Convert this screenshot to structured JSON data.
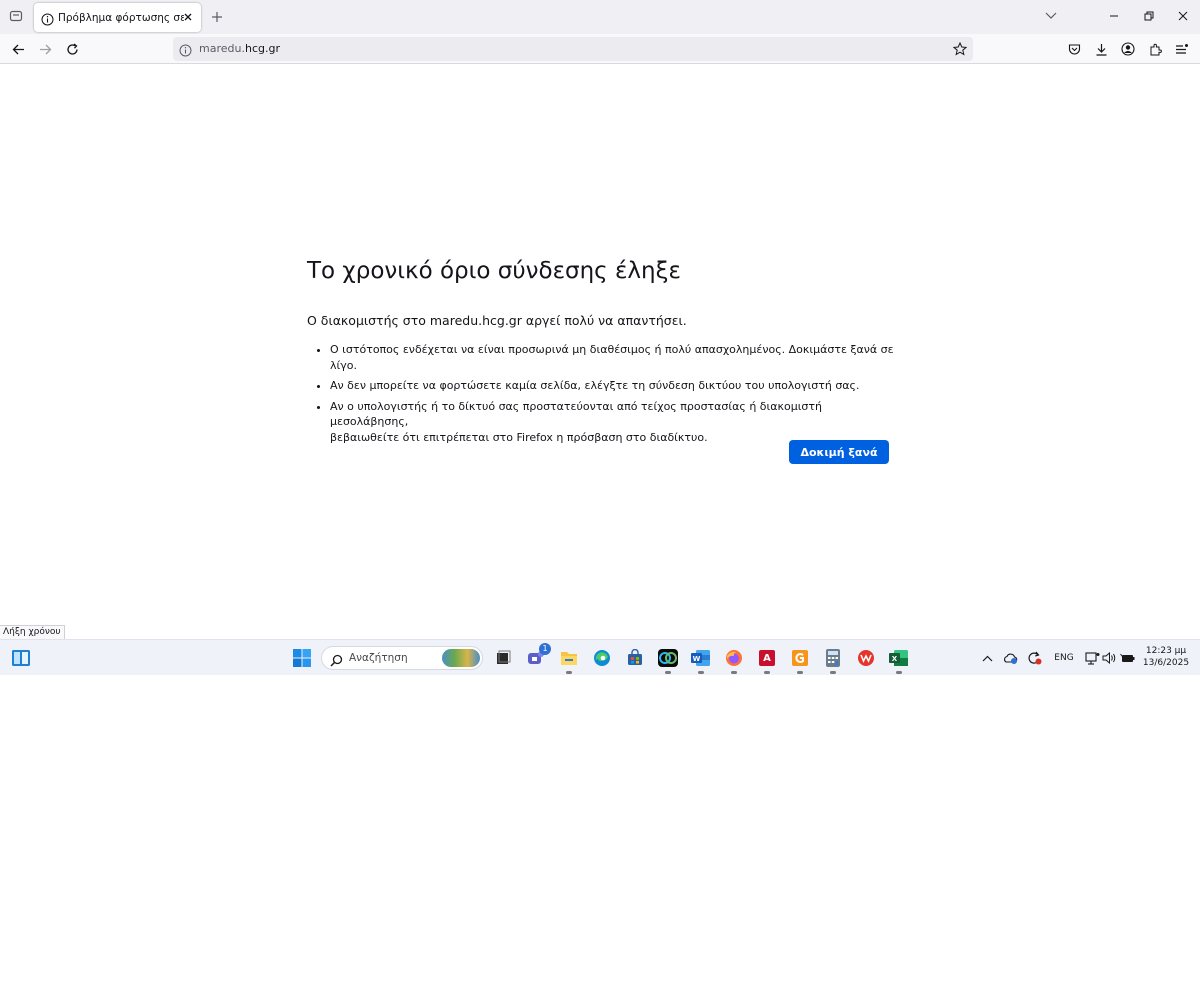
{
  "browser": {
    "tab": {
      "title": "Πρόβλημα φόρτωσης σελίδας"
    },
    "url": {
      "prefix": "maredu.",
      "domain": "hcg.gr"
    }
  },
  "error_page": {
    "title": "Το χρονικό όριο σύνδεσης έληξε",
    "description": "Ο διακομιστής στο maredu.hcg.gr αργεί πολύ να απαντήσει.",
    "bullets": [
      "Ο ιστότοπος ενδέχεται να είναι προσωρινά μη διαθέσιμος ή πολύ απασχολημένος. Δοκιμάστε ξανά σε λίγο.",
      "Αν δεν μπορείτε να φορτώσετε καμία σελίδα, ελέγξτε τη σύνδεση δικτύου του υπολογιστή σας."
    ],
    "bullet3_line1": "Αν ο υπολογιστής ή το δίκτυό σας προστατεύονται από τείχος προστασίας ή διακομιστή μεσολάβησης,",
    "bullet3_line2": "βεβαιωθείτε ότι επιτρέπεται στο Firefox η πρόσβαση στο διαδίκτυο.",
    "retry_label": "Δοκιμή ξανά",
    "accent_color": "#0061e0"
  },
  "status_tooltip": "Λήξη χρόνου",
  "taskbar": {
    "search_placeholder": "Αναζήτηση",
    "teams_badge": "1",
    "language": "ENG",
    "time": "12:23 μμ",
    "date": "13/6/2025",
    "apps": [
      "widgets-icon",
      "start-icon",
      "search",
      "task-view-icon",
      "teams-icon",
      "file-explorer-icon",
      "edge-icon",
      "store-icon",
      "webex-icon",
      "word-icon",
      "firefox-icon",
      "autocad-icon",
      "taskbar-app-icon",
      "calculator-icon",
      "wps-icon",
      "excel-icon"
    ]
  }
}
